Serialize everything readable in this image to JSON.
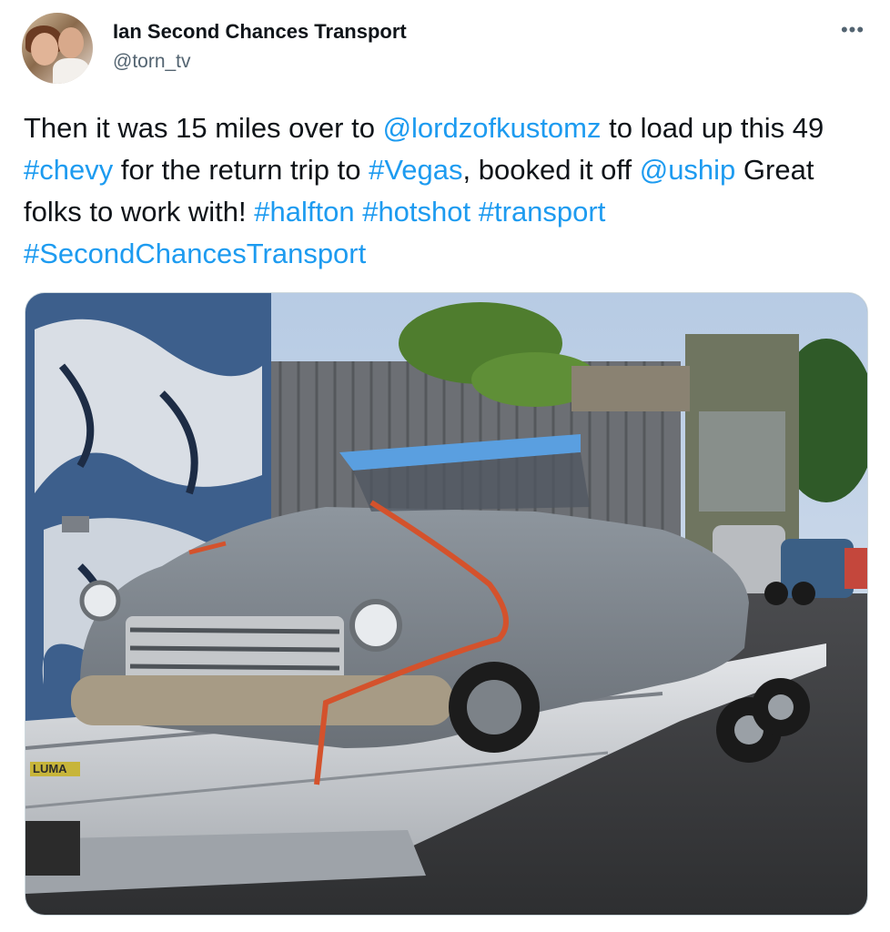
{
  "author": {
    "name": "Ian Second Chances Transport",
    "handle": "@torn_tv"
  },
  "more_icon": "more-horizontal-icon",
  "tweet": {
    "part1": "Then it was 15 miles over to ",
    "mention1": "@lordzofkustomz",
    "part2": " to load up this 49 ",
    "hashtag1": "#chevy",
    "part3": " for the return trip to ",
    "hashtag2": "#Vegas",
    "part4": ", booked it off ",
    "mention2": "@uship",
    "part5": " Great folks to work with! ",
    "hashtag3": "#halfton",
    "hashtag4": "#hotshot",
    "hashtag5": "#transport",
    "hashtag6": "#SecondChancesTransport"
  },
  "media": {
    "trailer_brand": "LUMA"
  },
  "colors": {
    "link": "#1d9bf0",
    "text": "#0f1419",
    "secondary": "#536471"
  }
}
